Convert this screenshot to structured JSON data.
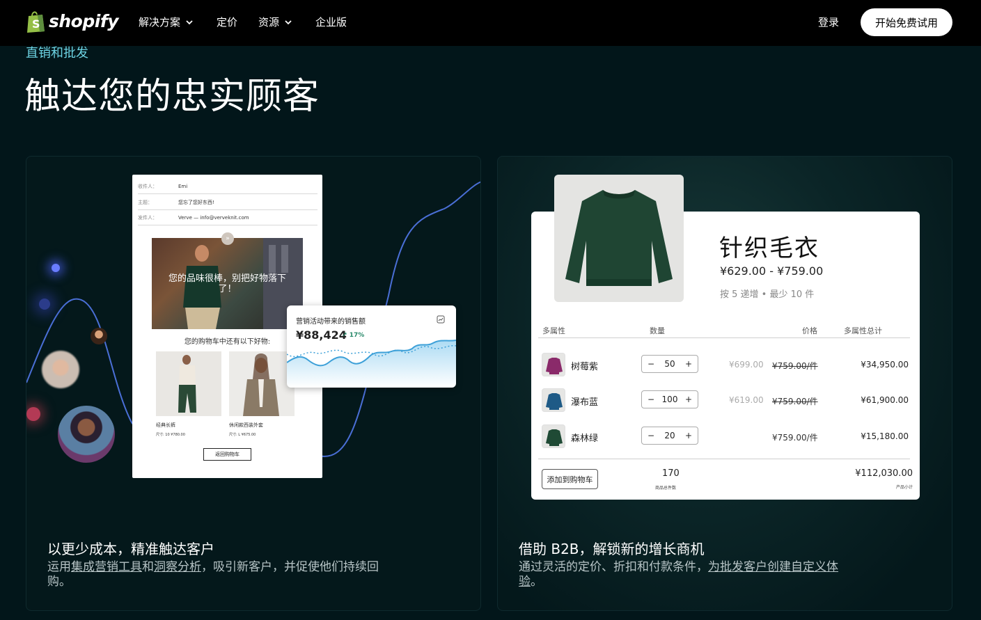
{
  "nav": {
    "brand": "shopify",
    "items": [
      "解决方案",
      "定价",
      "资源",
      "企业版"
    ],
    "login": "登录",
    "cta": "开始免费试用"
  },
  "hero": {
    "eyebrow": "直销和批发",
    "headline": "触达您的忠实顾客"
  },
  "left_card": {
    "title": "以更少成本，精准触达客户",
    "desc_prefix": "运用",
    "link1": "集成营销工具",
    "desc_and": "和",
    "link2": "洞察分析",
    "desc_suffix": "，吸引新客户，并促使他们持续回购。",
    "email": {
      "to_label": "收件人：",
      "to_value": "Emi",
      "subject_label": "主题：",
      "subject_value": "您忘了您好东西!",
      "from_label": "发件人：",
      "from_value": "Verve — info@verveknit.com",
      "hero_text": "您的品味很棒，别把好物落下了！",
      "sub_text": "您的购物车中还有以下好物:",
      "products": [
        {
          "name": "经典长裤",
          "meta": "尺寸: 10    ¥780.00"
        },
        {
          "name": "休闲款西装外套",
          "meta": "尺寸: L    ¥675.00"
        }
      ],
      "button": "返回购物车"
    },
    "sales": {
      "label": "营销活动带来的销售额",
      "value": "¥88,424",
      "change": "17%"
    }
  },
  "right_card": {
    "title": "借助 B2B，解锁新的增长商机",
    "desc_prefix": "通过灵活的定价、折扣和付款条件，",
    "link": "为批发客户创建自定义体验",
    "desc_suffix": "。",
    "product": {
      "title": "针织毛衣",
      "price": "¥629.00 - ¥759.00",
      "note": "按 5 递增 • 最少 10 件",
      "headers": {
        "variant": "多属性",
        "qty": "数量",
        "price": "价格",
        "total": "多属性总计"
      },
      "rows": [
        {
          "name": "树莓紫",
          "qty": "50",
          "sale": "¥699.00",
          "orig": "¥759.00/件",
          "total": "¥34,950.00",
          "color": "#8a2a6a"
        },
        {
          "name": "瀑布蓝",
          "qty": "100",
          "sale": "¥619.00",
          "orig": "¥759.00/件",
          "total": "¥61,900.00",
          "color": "#1e5a86"
        },
        {
          "name": "森林绿",
          "qty": "20",
          "sale": "",
          "orig": "¥759.00/件",
          "total": "¥15,180.00",
          "color": "#1f4a35"
        }
      ],
      "add_to_cart": "添加到购物车",
      "qty_total": "170",
      "qty_label": "商品总件数",
      "sum_total": "¥112,030.00",
      "sum_label": "产品小计"
    }
  },
  "colors": {
    "background": "#02161a",
    "accent": "#6dd3e3",
    "curve": "#4a6fd6"
  }
}
